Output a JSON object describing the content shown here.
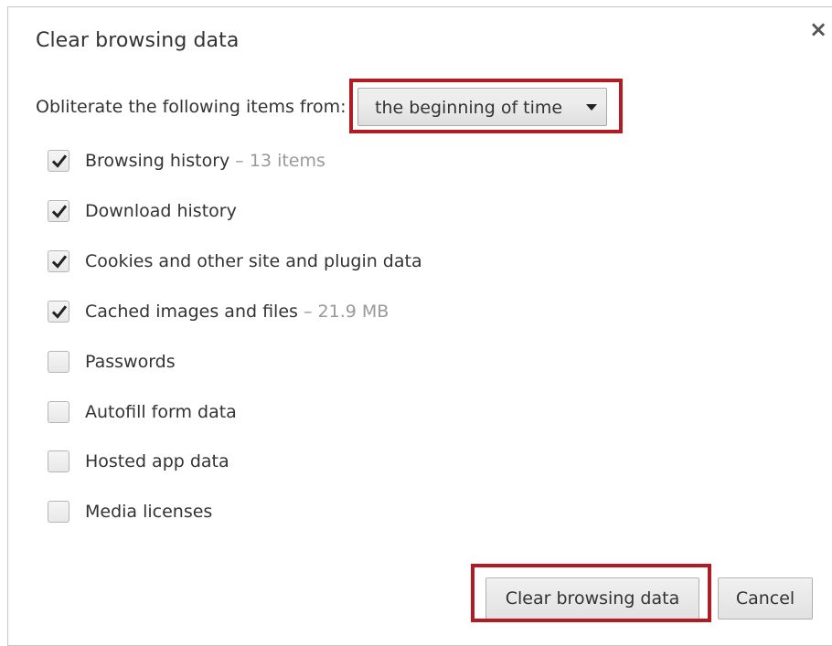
{
  "dialog": {
    "title": "Clear browsing data",
    "close_icon": "close-icon",
    "close_glyph": "×"
  },
  "range": {
    "label": "Obliterate the following items from:",
    "selected": "the beginning of time"
  },
  "options": [
    {
      "label": "Browsing history",
      "separator": " – ",
      "detail": "13 items",
      "checked": true
    },
    {
      "label": "Download history",
      "separator": "",
      "detail": "",
      "checked": true
    },
    {
      "label": "Cookies and other site and plugin data",
      "separator": "",
      "detail": "",
      "checked": true
    },
    {
      "label": "Cached images and files",
      "separator": " – ",
      "detail": "21.9 MB",
      "checked": true
    },
    {
      "label": "Passwords",
      "separator": "",
      "detail": "",
      "checked": false
    },
    {
      "label": "Autofill form data",
      "separator": "",
      "detail": "",
      "checked": false
    },
    {
      "label": "Hosted app data",
      "separator": "",
      "detail": "",
      "checked": false
    },
    {
      "label": "Media licenses",
      "separator": "",
      "detail": "",
      "checked": false
    }
  ],
  "buttons": {
    "clear": "Clear browsing data",
    "cancel": "Cancel"
  },
  "colors": {
    "highlight": "#b01c22",
    "detail_text": "#999999",
    "checkmark": "#222222"
  }
}
